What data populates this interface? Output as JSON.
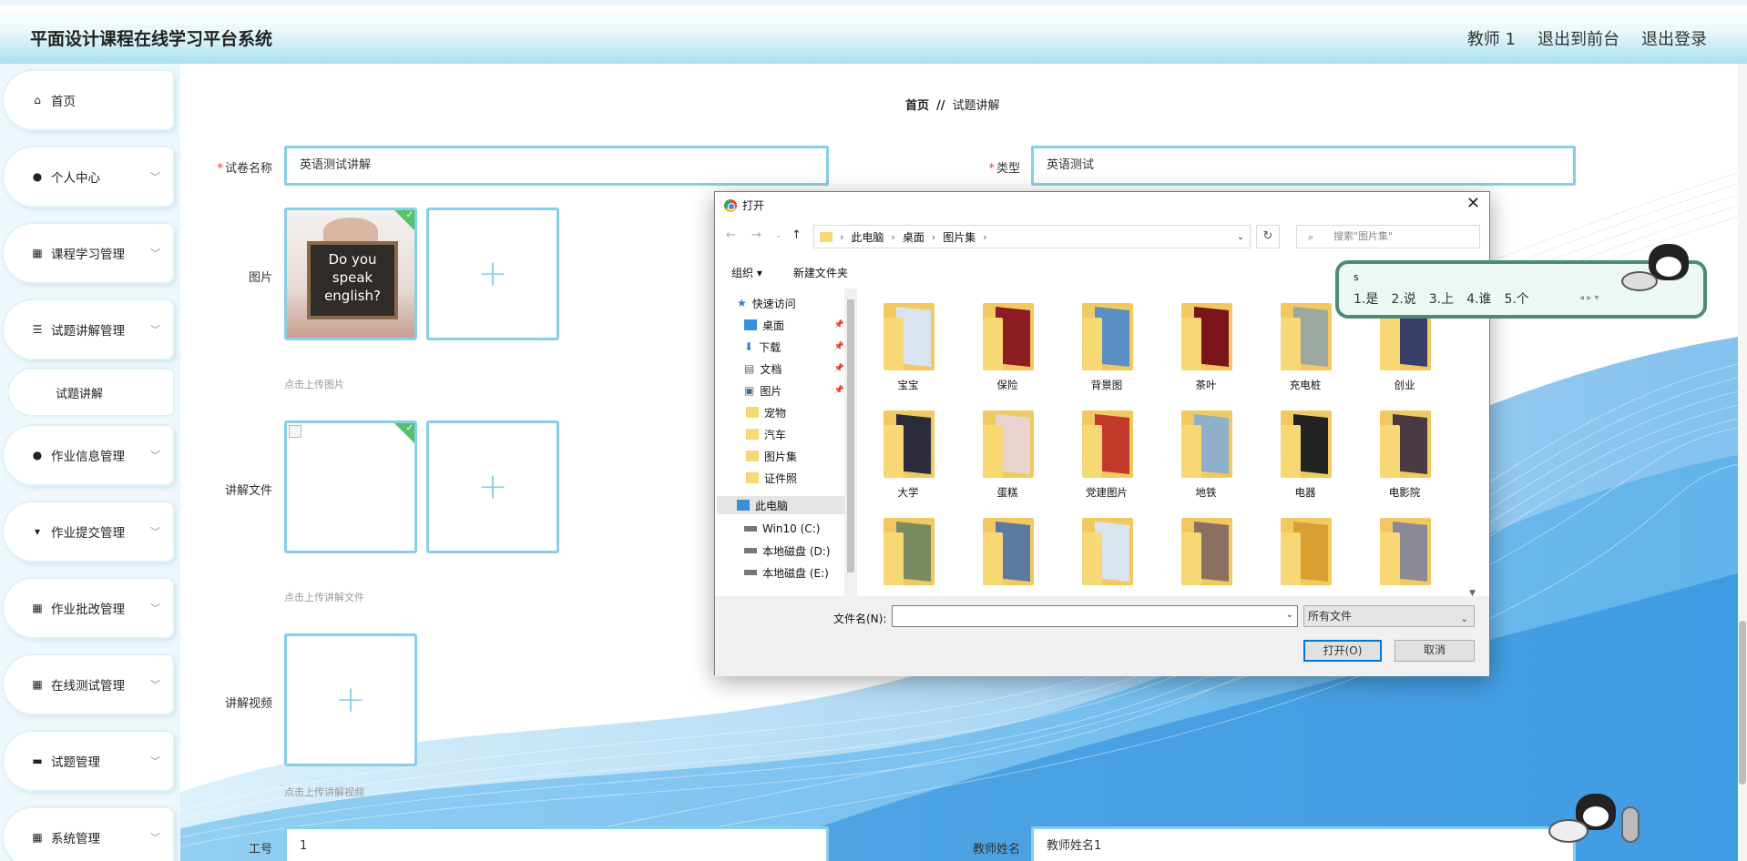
{
  "header": {
    "title": "平面设计课程在线学习平台系统",
    "nav": [
      "教师 1",
      "退出到前台",
      "退出登录"
    ]
  },
  "sidebar": {
    "items": [
      {
        "label": "首页",
        "icon": "home-icon",
        "glyph": "⌂",
        "chevron": false
      },
      {
        "label": "个人中心",
        "icon": "user-icon",
        "glyph": "●",
        "chevron": true
      },
      {
        "label": "课程学习管理",
        "icon": "grid-icon",
        "glyph": "▦",
        "chevron": true
      },
      {
        "label": "试题讲解管理",
        "icon": "list-icon",
        "glyph": "☰",
        "chevron": true
      },
      {
        "label": "作业信息管理",
        "icon": "user-icon",
        "glyph": "●",
        "chevron": true
      },
      {
        "label": "作业提交管理",
        "icon": "cup-icon",
        "glyph": "▾",
        "chevron": true
      },
      {
        "label": "作业批改管理",
        "icon": "grid-icon",
        "glyph": "▦",
        "chevron": true
      },
      {
        "label": "在线测试管理",
        "icon": "grid-icon",
        "glyph": "▦",
        "chevron": true
      },
      {
        "label": "试题管理",
        "icon": "monitor-icon",
        "glyph": "▬",
        "chevron": true
      },
      {
        "label": "系统管理",
        "icon": "grid-icon",
        "glyph": "▦",
        "chevron": true
      }
    ],
    "sub_item": "试题讲解"
  },
  "breadcrumb": {
    "home": "首页",
    "separator": "//",
    "current": "试题讲解"
  },
  "form": {
    "paper_name_label": "试卷名称",
    "paper_name_value": "英语测试讲解",
    "type_label": "类型",
    "type_value": "英语测试",
    "image_label": "图片",
    "image_hint": "点击上传图片",
    "image_text": "Do you speak english?",
    "file_label": "讲解文件",
    "file_hint": "点击上传讲解文件",
    "video_label": "讲解视频",
    "video_hint": "点击上传讲解视频",
    "job_no_label": "工号",
    "job_no_value": "1",
    "teacher_name_label": "教师姓名",
    "teacher_name_value": "教师姓名1",
    "plus": "+",
    "required_mark": "*"
  },
  "dialog": {
    "title": "打开",
    "close": "✕",
    "path": [
      "此电脑",
      "桌面",
      "图片集"
    ],
    "search_placeholder": "搜索\"图片集\"",
    "organize": "组织 ▾",
    "new_folder": "新建文件夹",
    "tree": [
      {
        "label": "快速访问",
        "icon": "star-icon"
      },
      {
        "label": "桌面",
        "icon": "desktop-icon",
        "pinned": true
      },
      {
        "label": "下载",
        "icon": "download-icon",
        "pinned": true
      },
      {
        "label": "文档",
        "icon": "document-icon",
        "pinned": true
      },
      {
        "label": "图片",
        "icon": "picture-icon",
        "pinned": true
      },
      {
        "label": "宠物",
        "icon": "folder-icon"
      },
      {
        "label": "汽车",
        "icon": "folder-icon"
      },
      {
        "label": "图片集",
        "icon": "folder-icon"
      },
      {
        "label": "证件照",
        "icon": "folder-icon"
      },
      {
        "label": "此电脑",
        "icon": "computer-icon",
        "selected": true
      },
      {
        "label": "Win10 (C:)",
        "icon": "drive-icon"
      },
      {
        "label": "本地磁盘 (D:)",
        "icon": "drive-icon"
      },
      {
        "label": "本地磁盘 (E:)",
        "icon": "drive-icon"
      }
    ],
    "folders": [
      {
        "name": "宝宝",
        "color": "#d9e4ee"
      },
      {
        "name": "保险",
        "color": "#8a1c22"
      },
      {
        "name": "背景图",
        "color": "#5b8fc4"
      },
      {
        "name": "茶叶",
        "color": "#7a1418"
      },
      {
        "name": "充电桩",
        "color": "#9aa8a0"
      },
      {
        "name": "创业",
        "color": "#3a3f6a"
      },
      {
        "name": "大学",
        "color": "#2b2b3a"
      },
      {
        "name": "蛋糕",
        "color": "#e8d3cf"
      },
      {
        "name": "党建图片",
        "color": "#c0392b"
      },
      {
        "name": "地铁",
        "color": "#8fb0c8"
      },
      {
        "name": "电器",
        "color": "#222222"
      },
      {
        "name": "电影院",
        "color": "#4a3a44"
      },
      {
        "name": "",
        "color": "#7a8a60"
      },
      {
        "name": "",
        "color": "#5a7aa0"
      },
      {
        "name": "",
        "color": "#d8e4ee"
      },
      {
        "name": "",
        "color": "#8a7060"
      },
      {
        "name": "",
        "color": "#d8a030"
      },
      {
        "name": "",
        "color": "#8a8a95"
      }
    ],
    "filename_label": "文件名(N):",
    "filename_value": "",
    "filetype": "所有文件",
    "open_button": "打开(O)",
    "cancel_button": "取消"
  },
  "ime": {
    "typed": "s",
    "candidates": [
      "1.是",
      "2.说",
      "3.上",
      "4.谁",
      "5.个"
    ],
    "arrows": "◂ ▸ ▾"
  },
  "colors": {
    "accent": "#86cfe6",
    "header_gradient_end": "#a9dff2",
    "required": "#ee3333",
    "primary_button_border": "#0078d7"
  }
}
